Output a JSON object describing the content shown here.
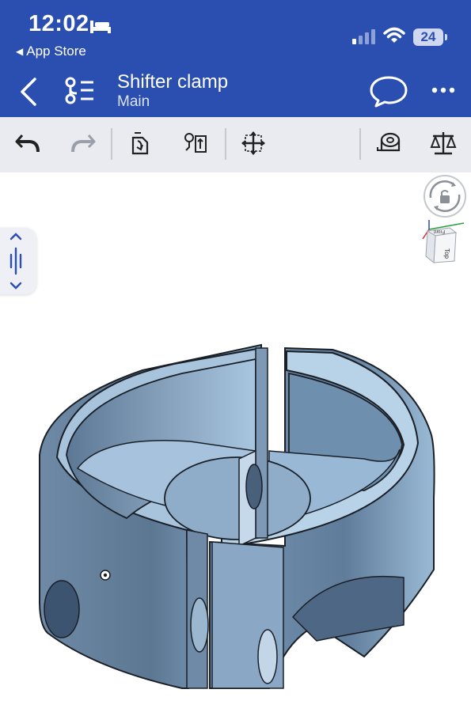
{
  "status_bar": {
    "time": "12:02",
    "back_app": "App Store",
    "battery": "24",
    "icons": [
      "bed-icon",
      "signal-icon",
      "wifi-icon",
      "battery-icon"
    ]
  },
  "nav": {
    "title": "Shifter clamp",
    "subtitle": "Main",
    "icons": [
      "chevron-left-icon",
      "feature-tree-icon",
      "comment-icon",
      "more-icon"
    ]
  },
  "toolbar": {
    "buttons": [
      "undo-icon",
      "redo-icon",
      "part-studio-icon",
      "mate-icon",
      "transform-icon",
      "measure-icon",
      "mass-properties-icon"
    ]
  },
  "viewport": {
    "view_cube": {
      "top_label": "Top",
      "front_label": "Front"
    }
  },
  "colors": {
    "brand_blue": "#2b4fb0",
    "toolbar_bg": "#e9ebf1",
    "model_fill": "#8fb0cf"
  }
}
